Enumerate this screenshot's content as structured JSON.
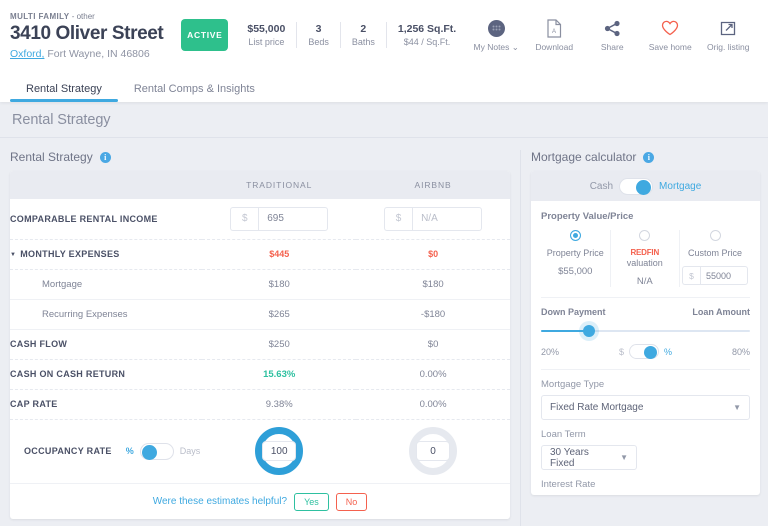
{
  "header": {
    "kicker_type": "MULTI FAMILY",
    "kicker_sep": " - ",
    "kicker_other": "other",
    "street": "3410 Oliver Street",
    "city_link": "Oxford,",
    "city_rest": " Fort Wayne, IN 46806",
    "status_badge": "ACTIVE",
    "stats": [
      {
        "value": "$55,000",
        "label": "List price"
      },
      {
        "value": "3",
        "label": "Beds"
      },
      {
        "value": "2",
        "label": "Baths"
      },
      {
        "value": "1,256 Sq.Ft.",
        "label": "$44 / Sq.Ft."
      }
    ],
    "actions": [
      {
        "icon": "notes-avatar-icon",
        "label": "My Notes ⌄"
      },
      {
        "icon": "pdf-download-icon",
        "label": "Download"
      },
      {
        "icon": "share-icon",
        "label": "Share"
      },
      {
        "icon": "heart-icon",
        "label": "Save home"
      },
      {
        "icon": "external-link-icon",
        "label": "Orig. listing"
      }
    ]
  },
  "tabs": [
    {
      "label": "Rental Strategy",
      "active": true
    },
    {
      "label": "Rental Comps & Insights",
      "active": false
    }
  ],
  "page_title": "Rental Strategy",
  "rental_strategy": {
    "section_title": "Rental Strategy",
    "columns": [
      "",
      "TRADITIONAL",
      "AIRBNB"
    ],
    "rows": [
      {
        "label": "COMPARABLE RENTAL INCOME",
        "type": "input",
        "traditional": {
          "prefix": "$",
          "value": "695"
        },
        "airbnb": {
          "prefix": "$",
          "value": "N/A",
          "placeholder": true
        }
      },
      {
        "label": "MONTHLY EXPENSES",
        "type": "expand",
        "traditional": "$445",
        "airbnb": "$0",
        "accent": "red"
      },
      {
        "label": "Mortgage",
        "type": "sub",
        "traditional": "$180",
        "airbnb": "$180"
      },
      {
        "label": "Recurring Expenses",
        "type": "sub",
        "traditional": "$265",
        "airbnb": "-$180"
      },
      {
        "label": "CASH FLOW",
        "type": "value",
        "traditional": "$250",
        "airbnb": "$0"
      },
      {
        "label": "CASH ON CASH RETURN",
        "type": "value",
        "traditional": "15.63%",
        "airbnb": "0.00%",
        "accent": "green"
      },
      {
        "label": "CAP RATE",
        "type": "value",
        "traditional": "9.38%",
        "airbnb": "0.00%"
      }
    ],
    "occupancy": {
      "label": "OCCUPANCY RATE",
      "unit_left": "%",
      "unit_right": "Days",
      "unit_selected": "%",
      "traditional_value": "100",
      "airbnb_value": "0"
    },
    "feedback": {
      "question": "Were these estimates helpful?",
      "yes": "Yes",
      "no": "No"
    }
  },
  "mortgage": {
    "section_title": "Mortgage calculator",
    "mode_left": "Cash",
    "mode_right": "Mortgage",
    "mode_selected": "Mortgage",
    "property_value_label": "Property Value/Price",
    "price_options": [
      {
        "name": "Property Price",
        "value": "$55,000",
        "selected": true
      },
      {
        "name": "valuation",
        "brand": "REDFIN",
        "value": "N/A",
        "selected": false
      },
      {
        "name": "Custom Price",
        "value": "55000",
        "prefix": "$",
        "selected": false,
        "is_input": true
      }
    ],
    "down_payment_label": "Down Payment",
    "loan_amount_label": "Loan Amount",
    "down_payment_pct": "20%",
    "loan_amount_pct": "80%",
    "dp_unit_left": "$",
    "dp_unit_right": "%",
    "dp_unit_selected": "%",
    "mortgage_type_label": "Mortgage Type",
    "mortgage_type_value": "Fixed Rate Mortgage",
    "loan_term_label": "Loan Term",
    "loan_term_value": "30 Years Fixed",
    "interest_rate_label": "Interest Rate"
  },
  "colors": {
    "accent_blue": "#3fa9e0",
    "green": "#2ec08c",
    "red": "#f4614e",
    "teal": "#2ec0a0"
  }
}
